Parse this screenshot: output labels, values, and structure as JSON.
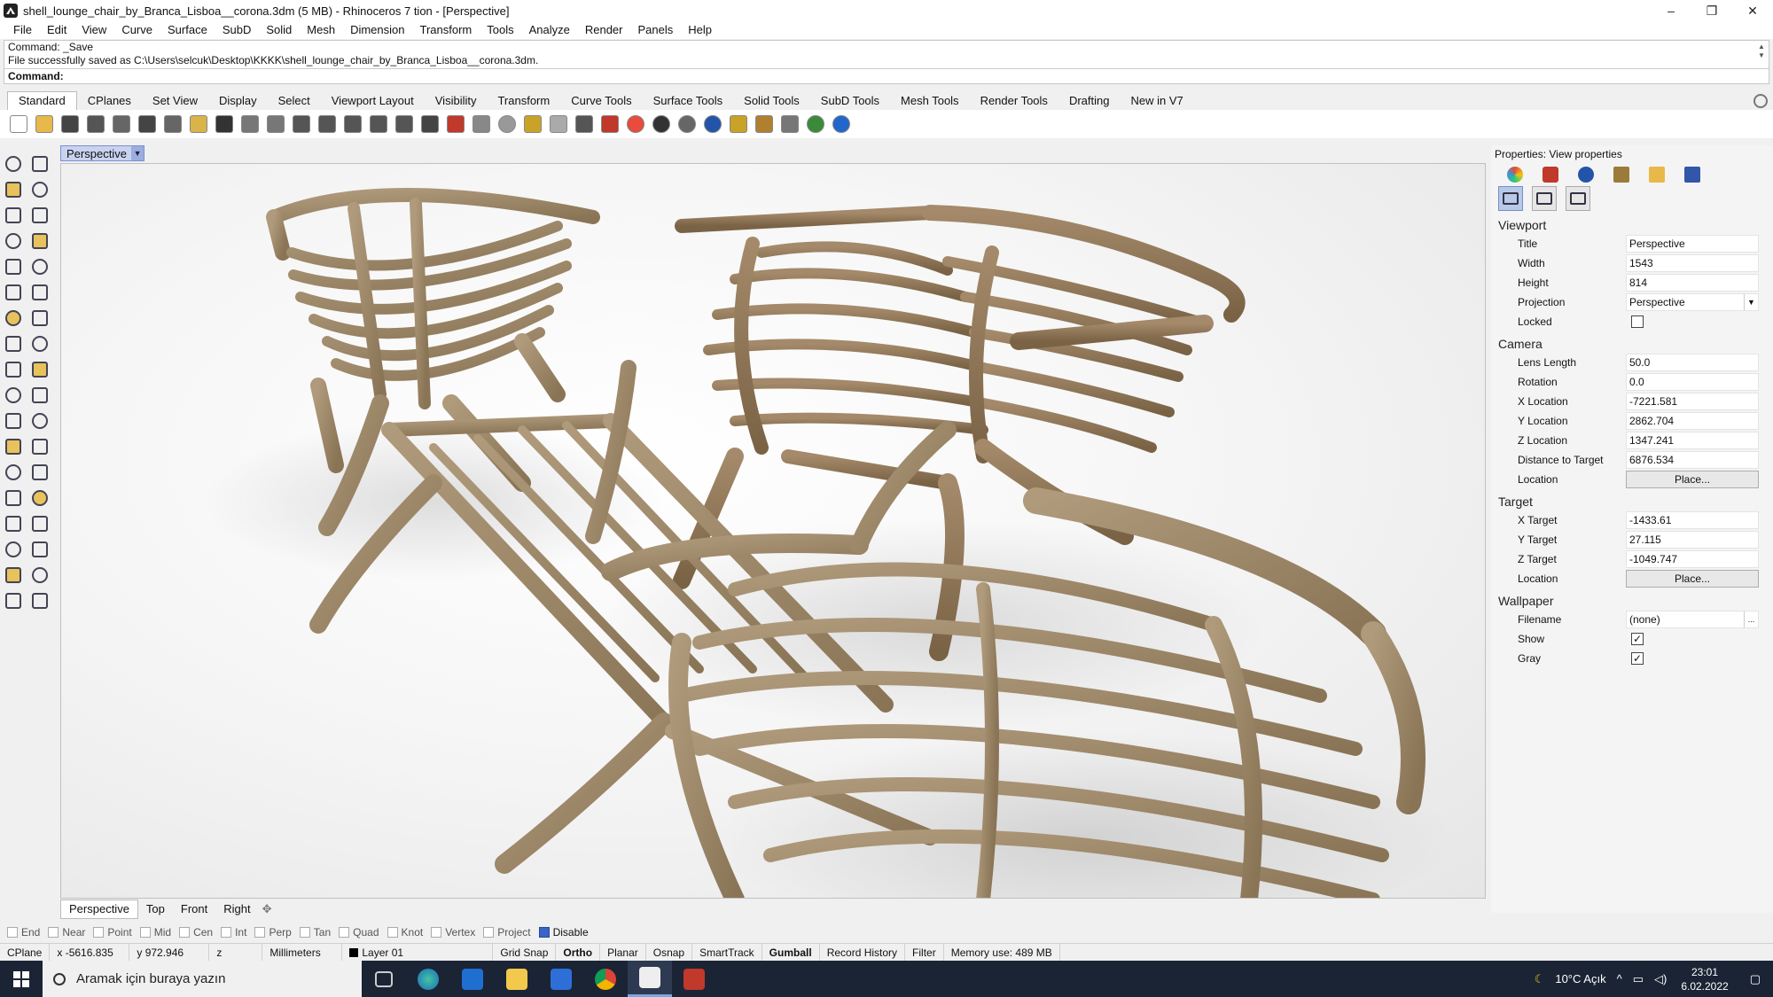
{
  "window": {
    "title": "shell_lounge_chair_by_Branca_Lisboa__corona.3dm (5 MB) - Rhinoceros 7 tion - [Perspective]",
    "controls": [
      "–",
      "❐",
      "✕"
    ]
  },
  "menu": [
    "File",
    "Edit",
    "View",
    "Curve",
    "Surface",
    "SubD",
    "Solid",
    "Mesh",
    "Dimension",
    "Transform",
    "Tools",
    "Analyze",
    "Render",
    "Panels",
    "Help"
  ],
  "command_history": [
    "Command: _Save",
    "File successfully saved as C:\\Users\\selcuk\\Desktop\\KKKK\\shell_lounge_chair_by_Branca_Lisboa__corona.3dm."
  ],
  "command_prompt": "Command:",
  "toolbar_tabs": [
    "Standard",
    "CPlanes",
    "Set View",
    "Display",
    "Select",
    "Viewport Layout",
    "Visibility",
    "Transform",
    "Curve Tools",
    "Surface Tools",
    "Solid Tools",
    "SubD Tools",
    "Mesh Tools",
    "Render Tools",
    "Drafting",
    "New in V7"
  ],
  "toolbar_icons": [
    {
      "name": "new-icon",
      "color": "#ffffff"
    },
    {
      "name": "open-icon",
      "color": "#e8b84a"
    },
    {
      "name": "save-icon",
      "color": "#444444"
    },
    {
      "name": "print-icon",
      "color": "#555555"
    },
    {
      "name": "import-icon",
      "color": "#666666"
    },
    {
      "name": "cut-icon",
      "color": "#444444"
    },
    {
      "name": "copy-icon",
      "color": "#666666"
    },
    {
      "name": "paste-icon",
      "color": "#d9b44a"
    },
    {
      "name": "undo-icon",
      "color": "#333333"
    },
    {
      "name": "pan-icon",
      "color": "#777777"
    },
    {
      "name": "rotate-view-icon",
      "color": "#777777"
    },
    {
      "name": "zoom-icon",
      "color": "#555555"
    },
    {
      "name": "zoom-window-icon",
      "color": "#555555"
    },
    {
      "name": "zoom-extents-icon",
      "color": "#555555"
    },
    {
      "name": "zoom-selected-icon",
      "color": "#555555"
    },
    {
      "name": "undo-view-icon",
      "color": "#555555"
    },
    {
      "name": "viewport-layout-icon",
      "color": "#444444"
    },
    {
      "name": "car-icon",
      "color": "#c0392b"
    },
    {
      "name": "plane-icon",
      "color": "#888888"
    },
    {
      "name": "sun-icon",
      "color": "#999999"
    },
    {
      "name": "points-icon",
      "color": "#c9a227"
    },
    {
      "name": "light-bulb-icon",
      "color": "#aaaaaa"
    },
    {
      "name": "lock-icon",
      "color": "#555555"
    },
    {
      "name": "material-icon",
      "color": "#c0392b"
    },
    {
      "name": "render-color-icon",
      "color": "#e74c3c"
    },
    {
      "name": "shaded-icon",
      "color": "#333333"
    },
    {
      "name": "rendered-icon",
      "color": "#666666"
    },
    {
      "name": "sphere-icon",
      "color": "#2255aa"
    },
    {
      "name": "filter-icon",
      "color": "#c9a227"
    },
    {
      "name": "settings-icon",
      "color": "#b08030"
    },
    {
      "name": "grid-icon",
      "color": "#777777"
    },
    {
      "name": "globe-icon",
      "color": "#3a8a3a"
    },
    {
      "name": "help-icon",
      "color": "#2266cc"
    }
  ],
  "viewport": {
    "label": "Perspective",
    "tabs": [
      "Perspective",
      "Top",
      "Front",
      "Right"
    ],
    "add": "✥"
  },
  "osnaps": [
    {
      "label": "End",
      "on": false
    },
    {
      "label": "Near",
      "on": false
    },
    {
      "label": "Point",
      "on": false
    },
    {
      "label": "Mid",
      "on": false
    },
    {
      "label": "Cen",
      "on": false
    },
    {
      "label": "Int",
      "on": false
    },
    {
      "label": "Perp",
      "on": false
    },
    {
      "label": "Tan",
      "on": false
    },
    {
      "label": "Quad",
      "on": false
    },
    {
      "label": "Knot",
      "on": false
    },
    {
      "label": "Vertex",
      "on": false
    },
    {
      "label": "Project",
      "on": false
    },
    {
      "label": "Disable",
      "on": true
    }
  ],
  "status": {
    "cplane": "CPlane",
    "x": "x -5616.835",
    "y": "y 972.946",
    "z": "z",
    "units": "Millimeters",
    "layer": "Layer 01",
    "toggles": [
      {
        "label": "Grid Snap",
        "bold": false
      },
      {
        "label": "Ortho",
        "bold": true
      },
      {
        "label": "Planar",
        "bold": false
      },
      {
        "label": "Osnap",
        "bold": false
      },
      {
        "label": "SmartTrack",
        "bold": false
      },
      {
        "label": "Gumball",
        "bold": true
      },
      {
        "label": "Record History",
        "bold": false
      },
      {
        "label": "Filter",
        "bold": false
      }
    ],
    "memory": "Memory use: 489 MB"
  },
  "properties": {
    "header": "Properties: View properties",
    "viewport_section": "Viewport",
    "viewport_rows": [
      {
        "key": "Title",
        "value": "Perspective"
      },
      {
        "key": "Width",
        "value": "1543"
      },
      {
        "key": "Height",
        "value": "814"
      },
      {
        "key": "Projection",
        "value": "Perspective"
      }
    ],
    "locked_label": "Locked",
    "camera_section": "Camera",
    "camera_rows": [
      {
        "key": "Lens Length",
        "value": "50.0"
      },
      {
        "key": "Rotation",
        "value": "0.0"
      },
      {
        "key": "X Location",
        "value": "-7221.581"
      },
      {
        "key": "Y Location",
        "value": "2862.704"
      },
      {
        "key": "Z Location",
        "value": "1347.241"
      },
      {
        "key": "Distance to Target",
        "value": "6876.534"
      }
    ],
    "location_label": "Location",
    "place_button": "Place...",
    "target_section": "Target",
    "target_rows": [
      {
        "key": "X Target",
        "value": "-1433.61"
      },
      {
        "key": "Y Target",
        "value": "27.115"
      },
      {
        "key": "Z Target",
        "value": "-1049.747"
      }
    ],
    "wallpaper_section": "Wallpaper",
    "filename_label": "Filename",
    "filename_value": "(none)",
    "browse": "...",
    "show_label": "Show",
    "gray_label": "Gray",
    "checkmark": "✓"
  },
  "taskbar": {
    "search_placeholder": "Aramak için buraya yazın",
    "weather": "10°C Açık",
    "time": "23:01",
    "date": "6.02.2022"
  }
}
